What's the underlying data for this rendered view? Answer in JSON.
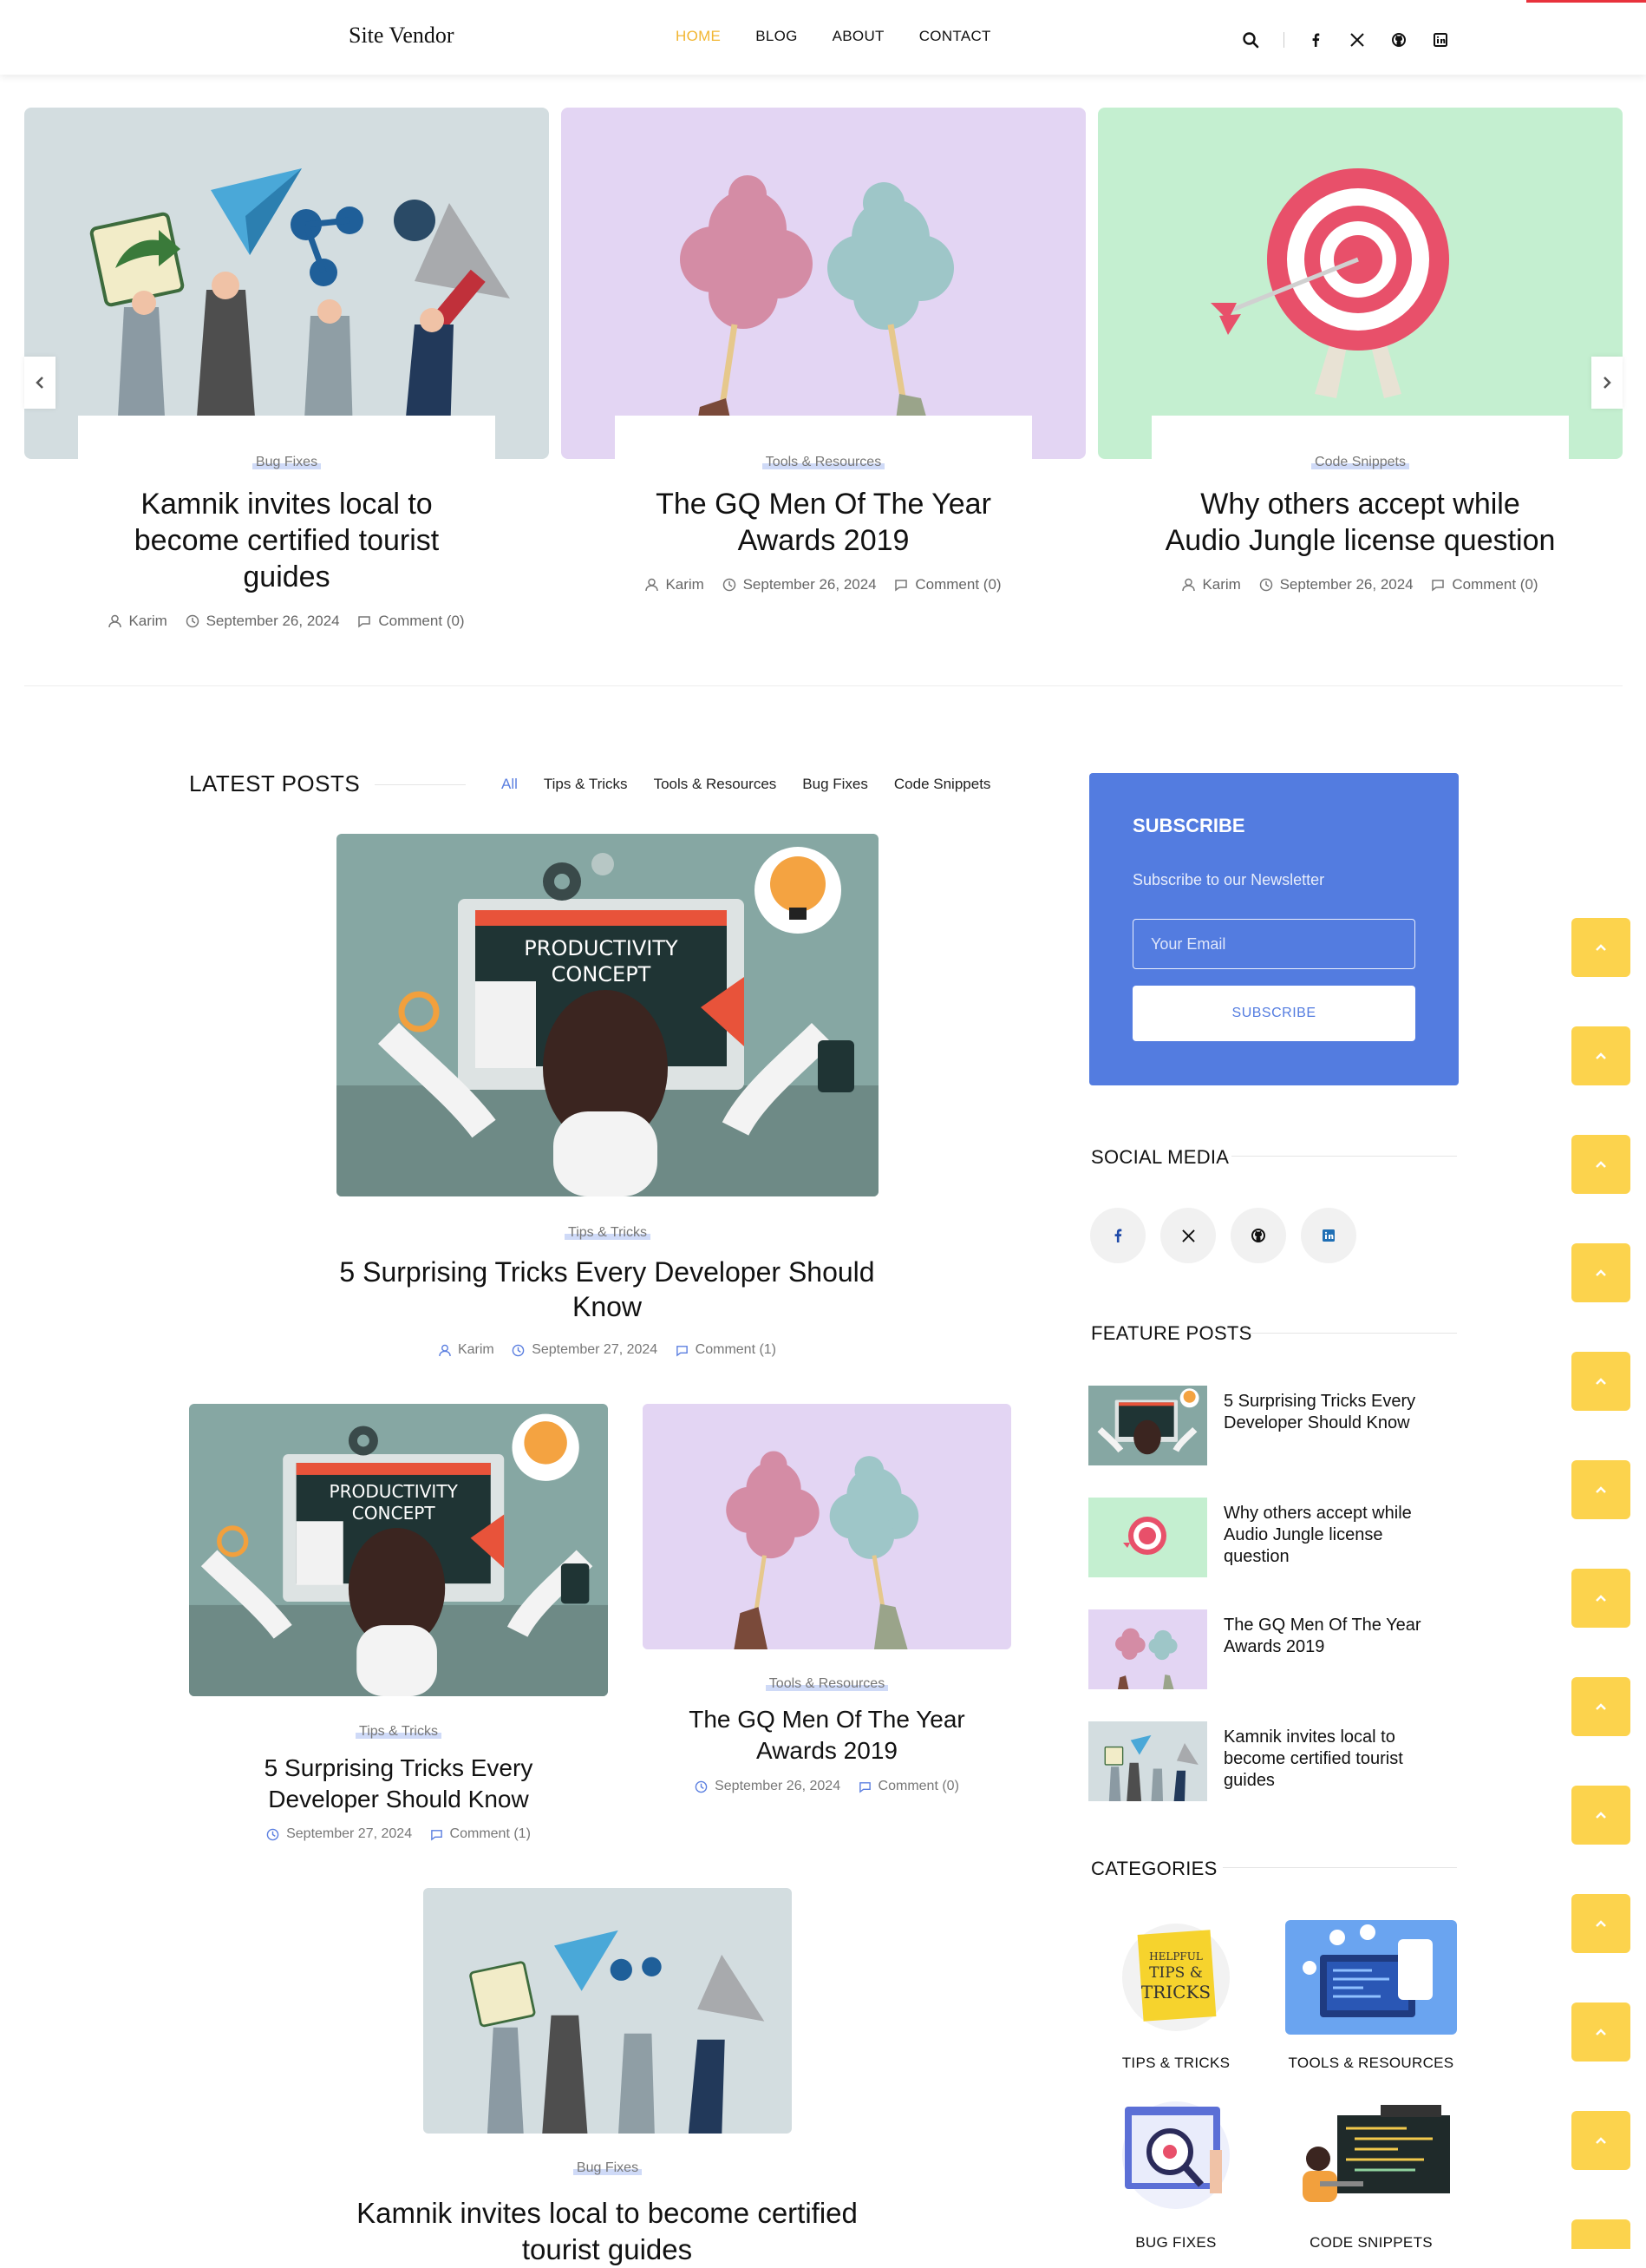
{
  "header": {
    "logo": "Site Vendor",
    "nav": [
      "HOME",
      "BLOG",
      "ABOUT",
      "CONTACT"
    ],
    "active_nav": "HOME",
    "icons": [
      "search-icon",
      "facebook-icon",
      "x-icon",
      "github-icon",
      "linkedin-icon"
    ]
  },
  "slider": [
    {
      "category": "Bug Fixes",
      "title_lines": [
        "Kamnik invites local to",
        "become certified tourist",
        "guides"
      ],
      "author": "Karim",
      "date": "September 26, 2024",
      "comments": "Comment (0)"
    },
    {
      "category": "Tools & Resources",
      "title_lines": [
        "The GQ Men Of The Year",
        "Awards 2019"
      ],
      "author": "Karim",
      "date": "September 26, 2024",
      "comments": "Comment (0)"
    },
    {
      "category": "Code Snippets",
      "title_lines": [
        "Why others accept while",
        "Audio Jungle license question"
      ],
      "author": "Karim",
      "date": "September 26, 2024",
      "comments": "Comment (0)"
    }
  ],
  "latest": {
    "heading": "LATEST POSTS",
    "filters": [
      "All",
      "Tips & Tricks",
      "Tools & Resources",
      "Bug Fixes",
      "Code Snippets"
    ],
    "active_filter": "All",
    "featured": {
      "category": "Tips & Tricks",
      "title_lines": [
        "5 Surprising Tricks Every Developer Should",
        "Know"
      ],
      "author": "Karim",
      "date": "September 27, 2024",
      "comments": "Comment (1)",
      "image_text": [
        "PRODUCTIVITY",
        "CONCEPT"
      ]
    },
    "post_left": {
      "category": "Tips & Tricks",
      "title_lines": [
        "5 Surprising Tricks Every",
        "Developer Should Know"
      ],
      "date": "September 27, 2024",
      "comments": "Comment (1)",
      "image_text": [
        "PRODUCTIVITY",
        "CONCEPT"
      ]
    },
    "post_right": {
      "category": "Tools & Resources",
      "title_lines": [
        "The GQ Men Of The Year",
        "Awards 2019"
      ],
      "date": "September 26, 2024",
      "comments": "Comment (0)"
    },
    "post_bottom": {
      "category": "Bug Fixes",
      "title_lines": [
        "Kamnik invites local to become certified",
        "tourist guides"
      ]
    }
  },
  "subscribe": {
    "title": "SUBSCRIBE",
    "description": "Subscribe to our Newsletter",
    "email_placeholder": "Your Email",
    "button": "SUBSCRIBE"
  },
  "social_media": {
    "heading": "SOCIAL MEDIA",
    "icons": [
      "facebook-icon",
      "x-icon",
      "github-icon",
      "linkedin-icon"
    ]
  },
  "feature_posts": {
    "heading": "FEATURE POSTS",
    "items": [
      {
        "title": "5 Surprising Tricks Every Developer Should Know"
      },
      {
        "title": "Why others accept while Audio Jungle license question"
      },
      {
        "title": "The GQ Men Of The Year Awards 2019"
      },
      {
        "title": "Kamnik invites local to become certified tourist guides"
      }
    ]
  },
  "categories": {
    "heading": "CATEGORIES",
    "items": [
      "TIPS & TRICKS",
      "TOOLS & RESOURCES",
      "BUG FIXES",
      "CODE SNIPPETS"
    ],
    "tips_image_text": [
      "HELPFUL",
      "TIPS &",
      "TRICKS"
    ]
  },
  "colors": {
    "accent": "#537ce0",
    "nav_active": "#f2b632",
    "scroll_top": "#fcd34d",
    "highlight": "#cfdaf7"
  }
}
